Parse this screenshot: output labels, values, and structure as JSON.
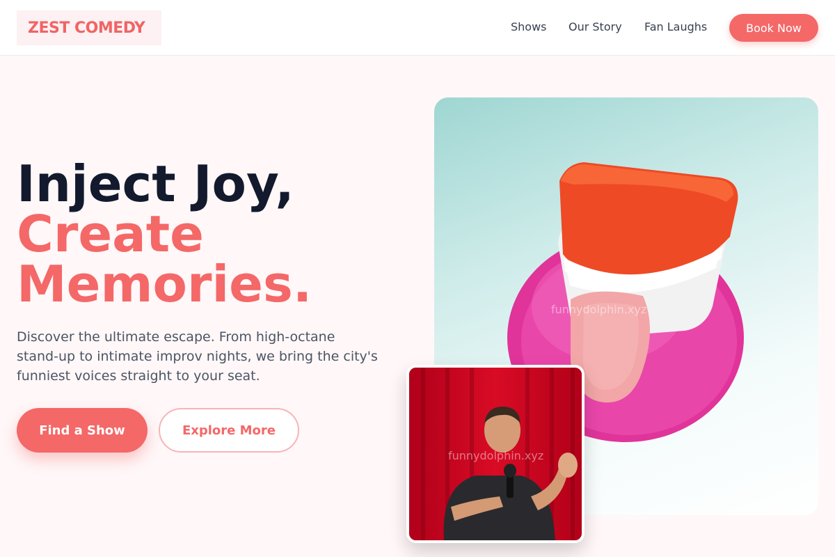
{
  "header": {
    "logo": "ZEST COMEDY",
    "nav": [
      "Shows",
      "Our Story",
      "Fan Laughs"
    ],
    "cta": "Book Now"
  },
  "hero": {
    "headline_line1": "Inject Joy,",
    "headline_line2": "Create",
    "headline_line3": "Memories.",
    "description": "Discover the ultimate escape. From high-octane stand-up to intimate improv nights, we bring the city's funniest voices straight to your seat.",
    "primary_button": "Find a Show",
    "secondary_button": "Explore More"
  },
  "images": {
    "main_watermark": "funnydolphin.xyz",
    "small_watermark": "funnydolphin.xyz"
  },
  "colors": {
    "accent": "#f46868",
    "headline_dark": "#131a2e",
    "page_bg": "#fff7f8"
  }
}
